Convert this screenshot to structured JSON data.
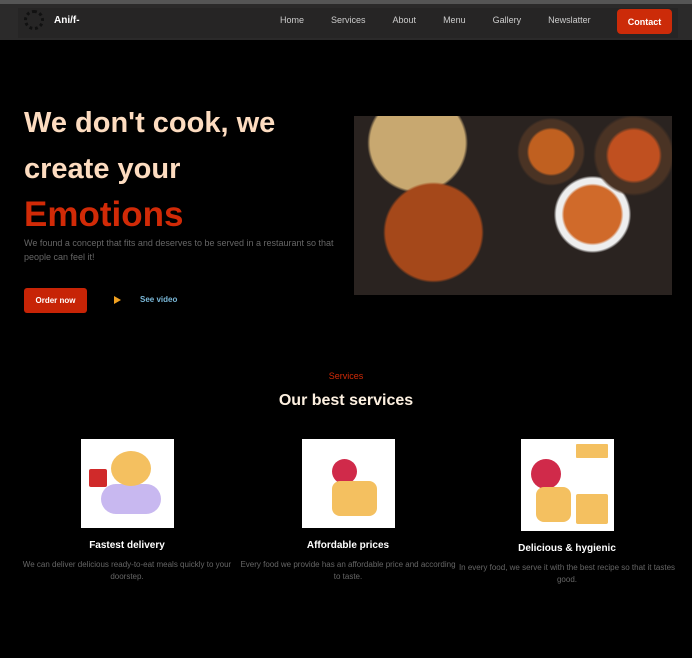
{
  "nav": {
    "brand": "Ani/f-",
    "links": [
      "Home",
      "Services",
      "About",
      "Menu",
      "Gallery",
      "Newslatter"
    ],
    "contact": "Contact"
  },
  "hero": {
    "line1": "We don't cook, we",
    "line2": "create your",
    "highlight": "Emotions",
    "description": "We found a concept that fits and deserves to be served in a restaurant so that people can feel it!",
    "order_button": "Order now",
    "video_link": "See video"
  },
  "services": {
    "label": "Services",
    "title": "Our best services",
    "cards": [
      {
        "title": "Fastest delivery",
        "text": "We can deliver delicious ready-to-eat meals quickly to your doorstep."
      },
      {
        "title": "Affordable prices",
        "text": "Every food we provide has an affordable price and according to taste."
      },
      {
        "title": "Delicious & hygienic",
        "text": "In every food, we serve it with the best recipe so that it tastes good."
      }
    ]
  }
}
